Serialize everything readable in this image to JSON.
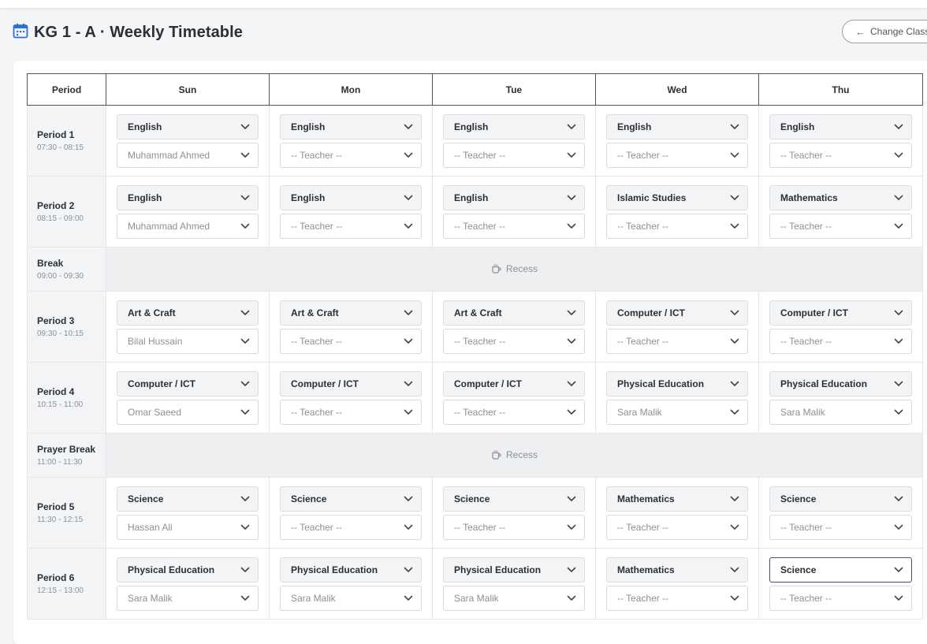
{
  "header": {
    "title": "KG 1 - A · Weekly Timetable",
    "change_class_label": "Change Class"
  },
  "columns": {
    "period": "Period",
    "days": [
      "Sun",
      "Mon",
      "Tue",
      "Wed",
      "Thu"
    ]
  },
  "recess_label": "Recess",
  "rows": [
    {
      "type": "period",
      "name": "Period 1",
      "time": "07:30 - 08:15",
      "cells": [
        {
          "subject": "English",
          "teacher": "Muhammad Ahmed"
        },
        {
          "subject": "English",
          "teacher": "-- Teacher --"
        },
        {
          "subject": "English",
          "teacher": "-- Teacher --"
        },
        {
          "subject": "English",
          "teacher": "-- Teacher --"
        },
        {
          "subject": "English",
          "teacher": "-- Teacher --"
        }
      ]
    },
    {
      "type": "period",
      "name": "Period 2",
      "time": "08:15 - 09:00",
      "cells": [
        {
          "subject": "English",
          "teacher": "Muhammad Ahmed"
        },
        {
          "subject": "English",
          "teacher": "-- Teacher --"
        },
        {
          "subject": "English",
          "teacher": "-- Teacher --"
        },
        {
          "subject": "Islamic Studies",
          "teacher": "-- Teacher --"
        },
        {
          "subject": "Mathematics",
          "teacher": "-- Teacher --"
        }
      ]
    },
    {
      "type": "break",
      "name": "Break",
      "time": "09:00 - 09:30"
    },
    {
      "type": "period",
      "name": "Period 3",
      "time": "09:30 - 10:15",
      "cells": [
        {
          "subject": "Art & Craft",
          "teacher": "Bilal Hussain"
        },
        {
          "subject": "Art & Craft",
          "teacher": "-- Teacher --"
        },
        {
          "subject": "Art & Craft",
          "teacher": "-- Teacher --"
        },
        {
          "subject": "Computer / ICT",
          "teacher": "-- Teacher --"
        },
        {
          "subject": "Computer / ICT",
          "teacher": "-- Teacher --"
        }
      ]
    },
    {
      "type": "period",
      "name": "Period 4",
      "time": "10:15 - 11:00",
      "cells": [
        {
          "subject": "Computer / ICT",
          "teacher": "Omar Saeed"
        },
        {
          "subject": "Computer / ICT",
          "teacher": "-- Teacher --"
        },
        {
          "subject": "Computer / ICT",
          "teacher": "-- Teacher --"
        },
        {
          "subject": "Physical Education",
          "teacher": "Sara Malik"
        },
        {
          "subject": "Physical Education",
          "teacher": "Sara Malik"
        }
      ]
    },
    {
      "type": "break",
      "name": "Prayer Break",
      "time": "11:00 - 11:30"
    },
    {
      "type": "period",
      "name": "Period 5",
      "time": "11:30 - 12:15",
      "cells": [
        {
          "subject": "Science",
          "teacher": "Hassan Ali"
        },
        {
          "subject": "Science",
          "teacher": "-- Teacher --"
        },
        {
          "subject": "Science",
          "teacher": "-- Teacher --"
        },
        {
          "subject": "Mathematics",
          "teacher": "-- Teacher --"
        },
        {
          "subject": "Science",
          "teacher": "-- Teacher --"
        }
      ]
    },
    {
      "type": "period",
      "name": "Period 6",
      "time": "12:15 - 13:00",
      "cells": [
        {
          "subject": "Physical Education",
          "teacher": "Sara Malik"
        },
        {
          "subject": "Physical Education",
          "teacher": "Sara Malik"
        },
        {
          "subject": "Physical Education",
          "teacher": "Sara Malik"
        },
        {
          "subject": "Mathematics",
          "teacher": "-- Teacher --"
        },
        {
          "subject": "Science",
          "teacher": "-- Teacher --",
          "focused": true
        }
      ]
    }
  ],
  "icons": {
    "header": "calendar-icon",
    "back": "arrow-left-icon",
    "dropdown": "chevron-down-icon",
    "recess": "coffee-cup-icon"
  },
  "colors": {
    "accent": "#2a6fd6",
    "focus_border": "#4a4f7a"
  }
}
